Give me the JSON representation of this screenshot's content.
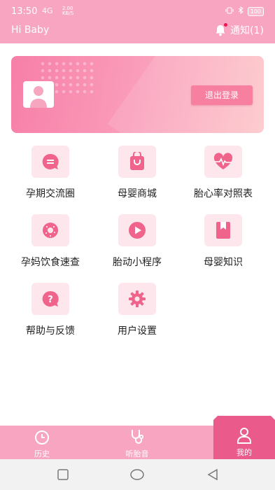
{
  "status_bar": {
    "time": "13:50",
    "network_label": "4G",
    "speed_value": "2.00",
    "speed_unit": "KB/S",
    "battery": "100"
  },
  "header": {
    "title": "Hi Baby",
    "notice_label": "通知(1)"
  },
  "profile_card": {
    "logout_label": "退出登录"
  },
  "menu": [
    {
      "label": "孕期交流圈",
      "icon": "chat-icon"
    },
    {
      "label": "母婴商城",
      "icon": "shopping-bag-icon"
    },
    {
      "label": "胎心率对照表",
      "icon": "heartbeat-icon"
    },
    {
      "label": "孕妈饮食速查",
      "icon": "donut-icon"
    },
    {
      "label": "胎动小程序",
      "icon": "play-icon"
    },
    {
      "label": "母婴知识",
      "icon": "bookmark-icon"
    },
    {
      "label": "帮助与反馈",
      "icon": "question-icon"
    },
    {
      "label": "用户设置",
      "icon": "gear-icon"
    }
  ],
  "tabbar": [
    {
      "label": "历史",
      "icon": "clock-icon",
      "active": false
    },
    {
      "label": "听胎音",
      "icon": "stethoscope-icon",
      "active": false
    },
    {
      "label": "我的",
      "icon": "person-icon",
      "active": true
    }
  ],
  "colors": {
    "brand_pink": "#f8a5c2",
    "active_tab": "#ea5a8a",
    "tile_bg": "#fde6ec",
    "icon_pink": "#f0648c"
  }
}
